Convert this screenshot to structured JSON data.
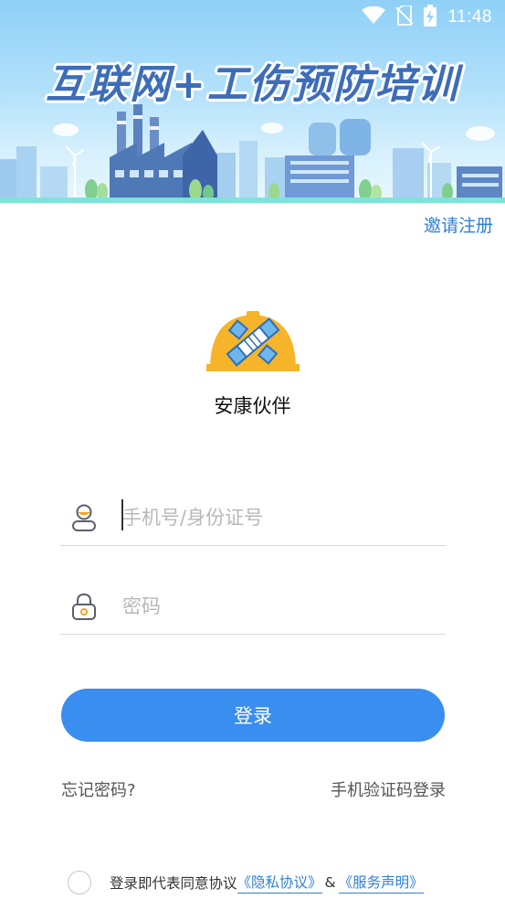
{
  "status_bar": {
    "time": "11:48",
    "icons": [
      "wifi-icon",
      "no-sim-icon",
      "battery-charging-icon"
    ]
  },
  "banner": {
    "title": "互联网+工伤预防培训"
  },
  "header": {
    "invite_register": "邀请注册"
  },
  "app": {
    "logo_icon": "helmet-handshake-icon",
    "name": "安康伙伴"
  },
  "form": {
    "phone": {
      "placeholder": "手机号/身份证号",
      "value": "",
      "icon": "user-icon"
    },
    "password": {
      "placeholder": "密码",
      "value": "",
      "icon": "lock-icon"
    },
    "login_label": "登录"
  },
  "links": {
    "forgot_password": "忘记密码?",
    "sms_login": "手机验证码登录"
  },
  "agreement": {
    "prefix": "登录即代表同意协议",
    "privacy": "《隐私协议》",
    "amp": "&",
    "terms": "《服务声明》"
  },
  "colors": {
    "accent": "#3a8ef0",
    "link": "#2f7fd6",
    "helmet": "#f6b42a",
    "banner_title": "#3d6db8"
  }
}
